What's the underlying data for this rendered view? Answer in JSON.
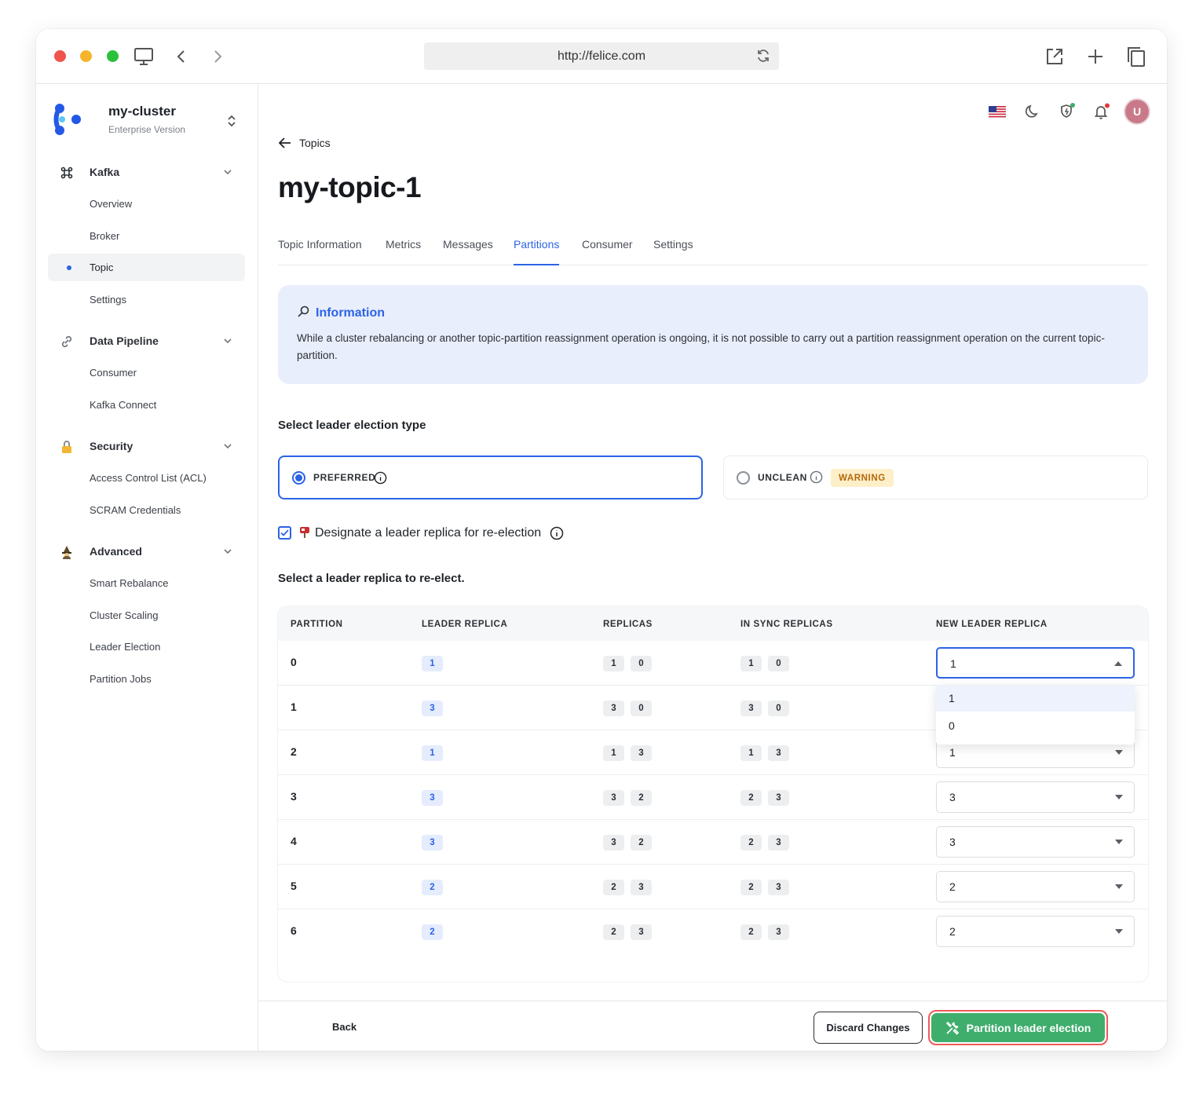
{
  "browser": {
    "url": "http://felice.com"
  },
  "sidebar": {
    "cluster_name": "my-cluster",
    "cluster_edition": "Enterprise Version",
    "sections": [
      {
        "label": "Kafka",
        "icon": "command-icon",
        "items": [
          "Overview",
          "Broker",
          "Topic",
          "Settings"
        ]
      },
      {
        "label": "Data Pipeline",
        "icon": "link-icon",
        "items": [
          "Consumer",
          "Kafka Connect"
        ]
      },
      {
        "label": "Security",
        "icon": "lock-icon",
        "items": [
          "Access Control List (ACL)",
          "SCRAM Credentials"
        ]
      },
      {
        "label": "Advanced",
        "icon": "wizard-icon",
        "items": [
          "Smart Rebalance",
          "Cluster Scaling",
          "Leader Election",
          "Partition Jobs"
        ]
      }
    ],
    "active_item": "Topic"
  },
  "header": {
    "avatar_initial": "U"
  },
  "page": {
    "back_label": "Topics",
    "title": "my-topic-1",
    "tabs": [
      "Topic Information",
      "Metrics",
      "Messages",
      "Partitions",
      "Consumer",
      "Settings"
    ],
    "active_tab": "Partitions"
  },
  "info": {
    "title": "Information",
    "text": "While a cluster rebalancing or another topic-partition reassignment operation is ongoing, it is not possible to carry out a partition reassignment operation on the current topic-partition."
  },
  "election": {
    "heading": "Select leader election type",
    "preferred_label": "PREFERRED",
    "unclean_label": "UNCLEAN",
    "warning_badge": "WARNING",
    "selected": "PREFERRED",
    "designate_label": "Designate a leader replica for re-election",
    "designate_checked": true
  },
  "replica_table": {
    "heading": "Select a leader replica to re-elect.",
    "columns": [
      "PARTITION",
      "LEADER REPLICA",
      "REPLICAS",
      "IN SYNC REPLICAS",
      "NEW LEADER REPLICA"
    ],
    "rows": [
      {
        "partition": "0",
        "leader": "1",
        "replicas": [
          "1",
          "0"
        ],
        "isr": [
          "1",
          "0"
        ],
        "new_leader": "1"
      },
      {
        "partition": "1",
        "leader": "3",
        "replicas": [
          "3",
          "0"
        ],
        "isr": [
          "3",
          "0"
        ],
        "new_leader": ""
      },
      {
        "partition": "2",
        "leader": "1",
        "replicas": [
          "1",
          "3"
        ],
        "isr": [
          "1",
          "3"
        ],
        "new_leader": "1"
      },
      {
        "partition": "3",
        "leader": "3",
        "replicas": [
          "3",
          "2"
        ],
        "isr": [
          "2",
          "3"
        ],
        "new_leader": "3"
      },
      {
        "partition": "4",
        "leader": "3",
        "replicas": [
          "3",
          "2"
        ],
        "isr": [
          "2",
          "3"
        ],
        "new_leader": "3"
      },
      {
        "partition": "5",
        "leader": "2",
        "replicas": [
          "2",
          "3"
        ],
        "isr": [
          "2",
          "3"
        ],
        "new_leader": "2"
      },
      {
        "partition": "6",
        "leader": "2",
        "replicas": [
          "2",
          "3"
        ],
        "isr": [
          "2",
          "3"
        ],
        "new_leader": "2"
      }
    ],
    "open_dropdown_options": [
      "1",
      "0"
    ],
    "highlighted_option": "1"
  },
  "footer": {
    "back_label": "Back",
    "discard_label": "Discard Changes",
    "submit_label": "Partition leader election"
  },
  "colors": {
    "accent": "#2c63e6",
    "success": "#3fae6d",
    "warning_bg": "#fdefc8",
    "warning_text": "#b4690e",
    "danger_outline": "#ef5a5a"
  }
}
